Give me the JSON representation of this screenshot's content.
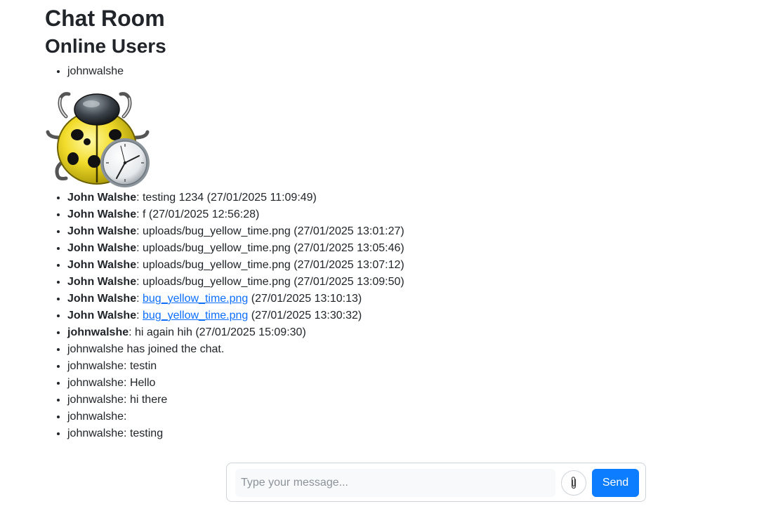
{
  "page": {
    "title": "Chat Room",
    "online_heading": "Online Users"
  },
  "online_users": [
    "johnwalshe"
  ],
  "image": {
    "icon": "bug-yellow-time-icon"
  },
  "messages": [
    {
      "user": "John Walshe",
      "bold": true,
      "sep": ": ",
      "text": "testing 1234 ",
      "link": "",
      "time": "(27/01/2025 11:09:49)"
    },
    {
      "user": "John Walshe",
      "bold": true,
      "sep": ": ",
      "text": "f ",
      "link": "",
      "time": "(27/01/2025 12:56:28)"
    },
    {
      "user": "John Walshe",
      "bold": true,
      "sep": ": ",
      "text": "uploads/bug_yellow_time.png ",
      "link": "",
      "time": "(27/01/2025 13:01:27)"
    },
    {
      "user": "John Walshe",
      "bold": true,
      "sep": ": ",
      "text": "uploads/bug_yellow_time.png ",
      "link": "",
      "time": "(27/01/2025 13:05:46)"
    },
    {
      "user": "John Walshe",
      "bold": true,
      "sep": ": ",
      "text": "uploads/bug_yellow_time.png ",
      "link": "",
      "time": "(27/01/2025 13:07:12)"
    },
    {
      "user": "John Walshe",
      "bold": true,
      "sep": ": ",
      "text": "uploads/bug_yellow_time.png ",
      "link": "",
      "time": "(27/01/2025 13:09:50)"
    },
    {
      "user": "John Walshe",
      "bold": true,
      "sep": ": ",
      "text": "",
      "link": "bug_yellow_time.png",
      "time": " (27/01/2025 13:10:13)"
    },
    {
      "user": "John Walshe",
      "bold": true,
      "sep": ": ",
      "text": "",
      "link": "bug_yellow_time.png",
      "time": " (27/01/2025 13:30:32)"
    },
    {
      "user": "johnwalshe",
      "bold": true,
      "sep": ": ",
      "text": "hi again hih ",
      "link": "",
      "time": "(27/01/2025 15:09:30)"
    },
    {
      "user": "",
      "bold": false,
      "sep": "",
      "text": "johnwalshe has joined the chat.",
      "link": "",
      "time": ""
    },
    {
      "user": "",
      "bold": false,
      "sep": "",
      "text": "johnwalshe: testin",
      "link": "",
      "time": ""
    },
    {
      "user": "",
      "bold": false,
      "sep": "",
      "text": "johnwalshe: Hello",
      "link": "",
      "time": ""
    },
    {
      "user": "",
      "bold": false,
      "sep": "",
      "text": "johnwalshe: hi there",
      "link": "",
      "time": ""
    },
    {
      "user": "",
      "bold": false,
      "sep": "",
      "text": "johnwalshe:",
      "link": "",
      "time": ""
    },
    {
      "user": "",
      "bold": false,
      "sep": "",
      "text": "johnwalshe: testing",
      "link": "",
      "time": ""
    }
  ],
  "composer": {
    "placeholder": "Type your message...",
    "value": "",
    "attach_icon": "paperclip-icon",
    "send_label": "Send"
  },
  "colors": {
    "accent": "#0d7dff",
    "link": "#0d6efd",
    "text": "#212529"
  }
}
